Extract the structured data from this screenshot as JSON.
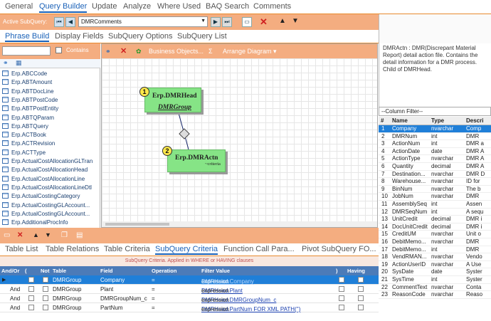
{
  "tabs_main": [
    "General",
    "Query Builder",
    "Update",
    "Analyze",
    "Where Used",
    "BAQ Search",
    "Comments"
  ],
  "active_subquery": {
    "label": "Active SubQuery:",
    "value": "DMRComments"
  },
  "tabs_sub": [
    "Phrase Build",
    "Display Fields",
    "SubQuery Options",
    "SubQuery List"
  ],
  "left": {
    "contains_label": "Contains",
    "tables": [
      "Erp.ABCCode",
      "Erp.ABTAmount",
      "Erp.ABTDocLine",
      "Erp.ABTPostCode",
      "Erp.ABTPostEntity",
      "Erp.ABTQParam",
      "Erp.ABTQuery",
      "Erp.ACTBook",
      "Erp.ACTRevision",
      "Erp.ACTType",
      "Erp.ActualCostAllocationGLTran",
      "Erp.ActualCostAllocationHead",
      "Erp.ActualCostAllocationLine",
      "Erp.ActualCostAllocationLineDtl",
      "Erp.ActualCostingCategory",
      "Erp.ActualCostingGLAccount...",
      "Erp.ActualCostingGLAccount...",
      "Erp.AdditionalProcInfo"
    ]
  },
  "canvas": {
    "toolbar": {
      "business_objects": "Business Objects...",
      "sigma": "Σ",
      "arrange": "Arrange Diagram ▾"
    },
    "node1": {
      "num": "1",
      "title": "Erp.DMRHead",
      "sub": "DMRGroup"
    },
    "node2": {
      "num": "2",
      "title": "Erp.DMRActn",
      "crit": "~criteria"
    }
  },
  "tabs_bottom": [
    "Table List",
    "Table Relations",
    "Table Criteria",
    "SubQuery Criteria",
    "Function Call Para...",
    "Pivot SubQuery FO..."
  ],
  "criteria_note": "SubQuery Criteria. Applied in WHERE or HAVING clauses",
  "criteria_headers": {
    "andor": "And/Or",
    "open": "(",
    "not": "Not",
    "table": "Table",
    "field": "Field",
    "operation": "Operation",
    "filter": "Filter Value",
    "close": ")",
    "having": "Having"
  },
  "criteria_rows": [
    {
      "andor": "",
      "table": "DMRGroup",
      "field": "Company",
      "op": "=",
      "link": "DMRHead.Company",
      "suffix": " expression",
      "selected": true
    },
    {
      "andor": "And",
      "table": "DMRGroup",
      "field": "Plant",
      "op": "=",
      "link": "DMRHead.Plant",
      "suffix": " expression",
      "selected": false
    },
    {
      "andor": "And",
      "table": "DMRGroup",
      "field": "DMRGroupNum_c",
      "op": "=",
      "link": "DMRHead.DMRGroupNum_c",
      "suffix": " expression",
      "selected": false
    },
    {
      "andor": "And",
      "table": "DMRGroup",
      "field": "PartNum",
      "op": "=",
      "link": "DMRHead.PartNum FOR XML PATH('')",
      "suffix": " expression",
      "selected": false
    }
  ],
  "description": "DMRActn : DMR(Discrepant Material Report) detail action file.  Contains the detail information for a DMR process.  Child of DMRHead.",
  "column_filter": "--Column Filter--",
  "col_headers": {
    "num": "#",
    "name": "Name",
    "type": "Type",
    "desc": "Descri"
  },
  "columns": [
    [
      "1",
      "Company",
      "nvarchar",
      "Comp"
    ],
    [
      "2",
      "DMRNum",
      "int",
      "DMR"
    ],
    [
      "3",
      "ActionNum",
      "int",
      "DMR a"
    ],
    [
      "4",
      "ActionDate",
      "date",
      "DMR A"
    ],
    [
      "5",
      "ActionType",
      "nvarchar",
      "DMR A"
    ],
    [
      "6",
      "Quantity",
      "decimal",
      "DMR A"
    ],
    [
      "7",
      "Destination...",
      "nvarchar",
      "DMR D"
    ],
    [
      "8",
      "Warehouse...",
      "nvarchar",
      "ID for"
    ],
    [
      "9",
      "BinNum",
      "nvarchar",
      "The b"
    ],
    [
      "10",
      "JobNum",
      "nvarchar",
      "DMR"
    ],
    [
      "11",
      "AssemblySeq",
      "int",
      "Assen"
    ],
    [
      "12",
      "DMRSeqNum",
      "int",
      "A sequ"
    ],
    [
      "13",
      "UnitCredit",
      "decimal",
      "DMR i"
    ],
    [
      "14",
      "DocUnitCredit",
      "decimal",
      "DMR i"
    ],
    [
      "15",
      "CreditUM",
      "nvarchar",
      "Unit o"
    ],
    [
      "16",
      "DebitMemo...",
      "nvarchar",
      "DMR"
    ],
    [
      "17",
      "DebitMemo...",
      "int",
      "DMR"
    ],
    [
      "18",
      "VendRMAN...",
      "nvarchar",
      "Vendo"
    ],
    [
      "19",
      "ActionUserID",
      "nvarchar",
      "A Use"
    ],
    [
      "20",
      "SysDate",
      "date",
      "Syster"
    ],
    [
      "21",
      "SysTime",
      "int",
      "Syster"
    ],
    [
      "22",
      "CommentText",
      "nvarchar",
      "Conta"
    ],
    [
      "23",
      "ReasonCode",
      "nvarchar",
      "Reaso"
    ]
  ]
}
